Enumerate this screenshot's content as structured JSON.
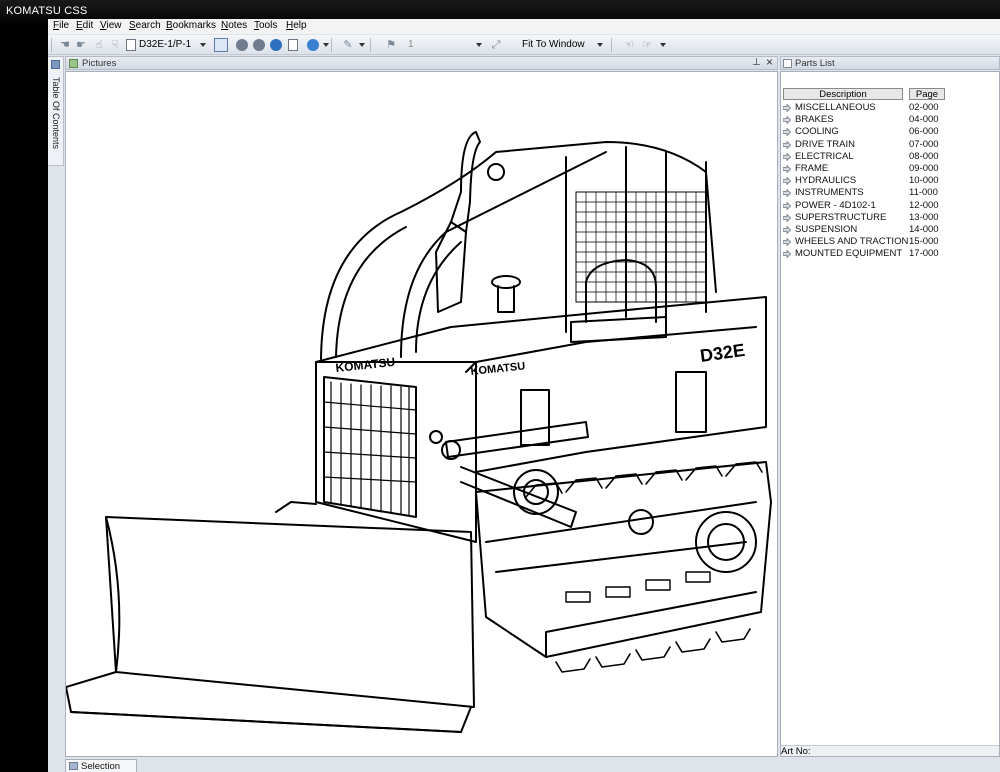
{
  "window": {
    "title": "KOMATSU CSS"
  },
  "menu": [
    "File",
    "Edit",
    "View",
    "Search",
    "Bookmarks",
    "Notes",
    "Tools",
    "Help"
  ],
  "toolbar": {
    "page_combo": "D32E-1/P-1",
    "page_number": "1",
    "zoom_combo": "Fit To Window"
  },
  "side_tab": {
    "label": "Table Of Contents"
  },
  "pictures_panel": {
    "title": "Pictures",
    "pin_glyph": "⊥",
    "close_glyph": "×",
    "model_label": "D32E",
    "brand_label": "KOMATSU"
  },
  "parts_panel": {
    "title": "Parts List",
    "col_description": "Description",
    "col_page": "Page",
    "rows": [
      {
        "desc": "MISCELLANEOUS",
        "page": "02-000"
      },
      {
        "desc": "BRAKES",
        "page": "04-000"
      },
      {
        "desc": "COOLING",
        "page": "06-000"
      },
      {
        "desc": "DRIVE TRAIN",
        "page": "07-000"
      },
      {
        "desc": "ELECTRICAL",
        "page": "08-000"
      },
      {
        "desc": "FRAME",
        "page": "09-000"
      },
      {
        "desc": "HYDRAULICS",
        "page": "10-000"
      },
      {
        "desc": "INSTRUMENTS",
        "page": "11-000"
      },
      {
        "desc": "POWER - 4D102-1",
        "page": "12-000"
      },
      {
        "desc": "SUPERSTRUCTURE",
        "page": "13-000"
      },
      {
        "desc": "SUSPENSION",
        "page": "14-000"
      },
      {
        "desc": "WHEELS AND TRACTION",
        "page": "15-000"
      },
      {
        "desc": "MOUNTED EQUIPMENT",
        "page": "17-000"
      }
    ],
    "art_no_label": "Art No:"
  },
  "bottom_tab": {
    "label": "Selection List"
  },
  "icons": {
    "row_arrow": "arrow-right-icon",
    "hand": "hand-icon",
    "nav": "nav-circle-icon"
  }
}
